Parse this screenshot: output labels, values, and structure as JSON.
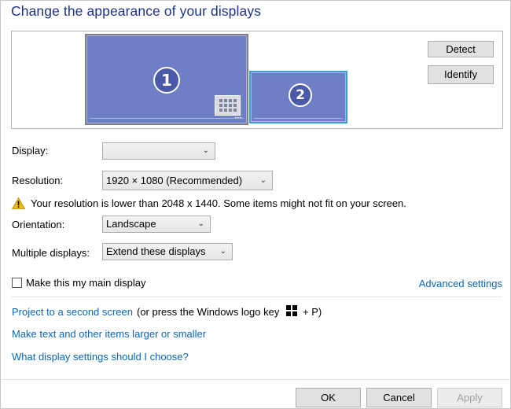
{
  "title": "Change the appearance of your displays",
  "monitors": [
    {
      "number": "1",
      "taskbar_dots": "•••"
    },
    {
      "number": "2"
    }
  ],
  "arrange_buttons": {
    "detect": "Detect",
    "identify": "Identify"
  },
  "display": {
    "label": "Display:",
    "value": ""
  },
  "resolution": {
    "label": "Resolution:",
    "value": "1920 × 1080 (Recommended)"
  },
  "warning": {
    "text": "Your resolution is lower than 2048 x 1440. Some items might not fit on your screen."
  },
  "orientation": {
    "label": "Orientation:",
    "value": "Landscape"
  },
  "multiple_displays": {
    "label": "Multiple displays:",
    "value": "Extend these displays"
  },
  "main_display": {
    "label": "Make this my main display",
    "checked": false
  },
  "links": {
    "advanced_settings": "Advanced settings",
    "project": "Project to a second screen",
    "project_suffix": "(or press the Windows logo key",
    "project_keys": "+ P)",
    "larger_text": "Make text and other items larger or smaller",
    "which_settings": "What display settings should I choose?"
  },
  "footer": {
    "ok": "OK",
    "cancel": "Cancel",
    "apply": "Apply"
  },
  "colors": {
    "title": "#1e3287",
    "link": "#0a66b5",
    "monitor_fill": "#6f7fc6",
    "monitor_selected_border": "#3c9ed6"
  }
}
